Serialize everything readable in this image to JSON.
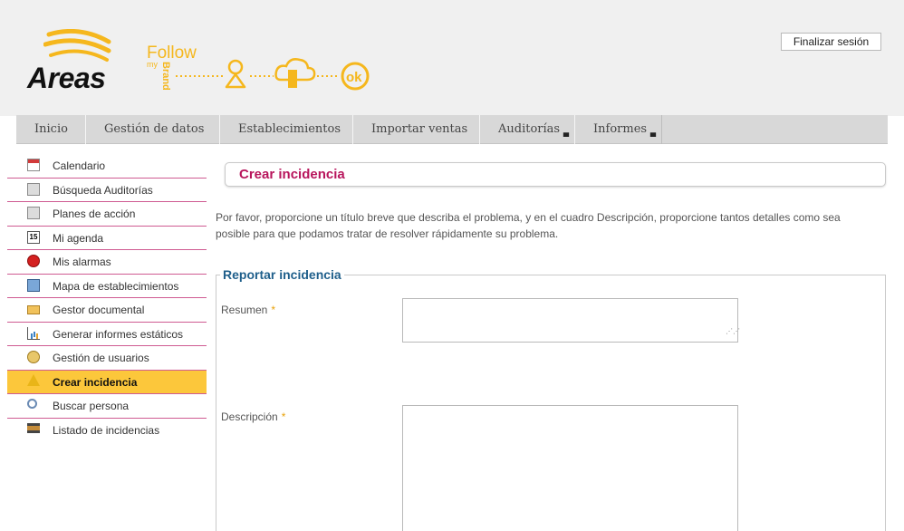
{
  "header": {
    "logo_text": "Areas",
    "brand_line1": "Follow",
    "brand_line2": "my",
    "brand_line3": "Brand",
    "ok_text": "ok",
    "logout_label": "Finalizar sesión",
    "accent_color": "#f5b71d"
  },
  "nav": {
    "items": [
      {
        "label": "Inicio",
        "has_dropdown": false
      },
      {
        "label": "Gestión de datos",
        "has_dropdown": false
      },
      {
        "label": "Establecimientos",
        "has_dropdown": false
      },
      {
        "label": "Importar ventas",
        "has_dropdown": false
      },
      {
        "label": "Auditorías",
        "has_dropdown": true
      },
      {
        "label": "Informes",
        "has_dropdown": true
      }
    ]
  },
  "sidebar": {
    "items": [
      {
        "label": "Calendario",
        "icon": "calendar-icon"
      },
      {
        "label": "Búsqueda Auditorías",
        "icon": "audit-search-icon"
      },
      {
        "label": "Planes de acción",
        "icon": "action-plan-icon"
      },
      {
        "label": "Mi agenda",
        "icon": "agenda-icon"
      },
      {
        "label": "Mis alarmas",
        "icon": "alarm-icon"
      },
      {
        "label": "Mapa de establecimientos",
        "icon": "map-icon"
      },
      {
        "label": "Gestor documental",
        "icon": "folder-icon"
      },
      {
        "label": "Generar informes estáticos",
        "icon": "chart-icon"
      },
      {
        "label": "Gestión de usuarios",
        "icon": "users-icon"
      },
      {
        "label": "Crear incidencia",
        "icon": "warning-icon",
        "active": true
      },
      {
        "label": "Buscar persona",
        "icon": "search-person-icon"
      },
      {
        "label": "Listado de incidencias",
        "icon": "list-icon"
      }
    ]
  },
  "main": {
    "title": "Crear incidencia",
    "intro": "Por favor, proporcione un título breve que describa el problema, y en el cuadro Descripción, proporcione tantos detalles como sea posible para que podamos tratar de resolver rápidamente su problema.",
    "form": {
      "legend": "Reportar incidencia",
      "summary_label": "Resumen",
      "summary_value": "",
      "description_label": "Descripción",
      "description_value": "",
      "required_mark": "*"
    }
  }
}
